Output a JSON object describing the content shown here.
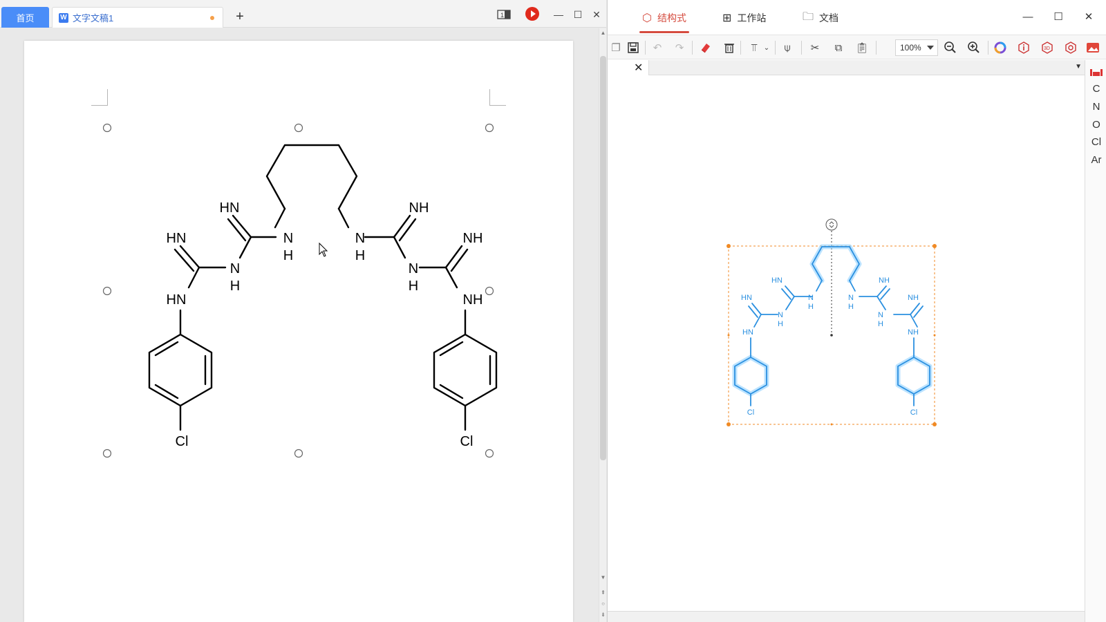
{
  "left_window": {
    "tabs": {
      "home_label": "首页",
      "doc_label": "文字文稿1",
      "add_label": "+"
    },
    "controls": {
      "minimize": "—",
      "maximize": "☐",
      "close": "✕"
    }
  },
  "structure_labels": {
    "hn_top_left": "HN",
    "nh_top_right": "NH",
    "hn_left": "HN",
    "nh_right": "NH",
    "n_left_inner": "N",
    "h_left_inner": "H",
    "n_right_inner": "N",
    "h_right_inner": "H",
    "n_left_mid": "N",
    "h_left_mid": "H",
    "n_right_mid": "N",
    "h_right_mid": "H",
    "hn_aryl_left": "HN",
    "nh_aryl_right": "NH",
    "cl_left": "Cl",
    "cl_right": "Cl"
  },
  "right_window": {
    "tabs": [
      {
        "label": "结构式",
        "icon": "hexagon-icon",
        "active": true
      },
      {
        "label": "工作站",
        "icon": "grid-icon",
        "active": false
      },
      {
        "label": "文档",
        "icon": "folder-icon",
        "active": false
      }
    ],
    "controls": {
      "minimize": "—",
      "maximize": "☐",
      "close": "✕"
    },
    "zoom": "100%",
    "doc_tab_close": "✕",
    "elements": [
      "C",
      "N",
      "O",
      "Cl",
      "Ar"
    ]
  },
  "colors": {
    "accent_red": "#d54b3e",
    "home_tab_blue": "#4a8df8",
    "selection_blue": "#3aa0e8",
    "selection_orange": "#f08a24"
  }
}
